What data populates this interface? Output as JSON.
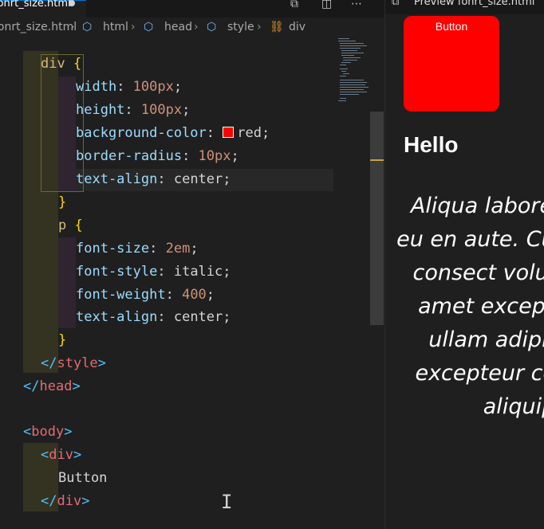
{
  "editor": {
    "active_tab": "fonrt_size.html",
    "breadcrumb": [
      "fonrt_size.html",
      "html",
      "head",
      "style",
      "div"
    ],
    "code_lines": {
      "l1_sel": "div",
      "l1_brace": " {",
      "width_prop": "width",
      "width_val": "100px",
      "height_prop": "height",
      "height_val": "100px",
      "bg_prop": "background-color",
      "bg_val": "red",
      "radius_prop": "border-radius",
      "radius_val": "10px",
      "talign_prop": "text-align",
      "talign_val": "center",
      "close_brace": "}",
      "p_sel": "p",
      "p_brace": " {",
      "fsize_prop": "font-size",
      "fsize_val": "2em",
      "fstyle_prop": "font-style",
      "fstyle_val": "italic",
      "fweight_prop": "font-weight",
      "fweight_val": "400",
      "talign2_prop": "text-align",
      "talign2_val": "center",
      "close_brace2": "}",
      "style_close": "style",
      "head_close": "head",
      "body_open": "body",
      "div_open": "div",
      "div_text": "Button",
      "div_close": "div"
    }
  },
  "preview": {
    "tab_title": "Preview fonrt_size.html",
    "box_text": "Button",
    "heading": "Hello",
    "paragraph": "Aliqua labore dolore eu en aute. Cupid sunt consect voluptate e amet excep labore ullam adipisicing excepteur co mollit aliquip",
    "box_color": "#ff0000"
  },
  "icons": {
    "split_preview": "split-preview-icon",
    "split_editor": "split-editor-icon",
    "more": "more-icon",
    "cube": "symbol-cube-icon",
    "chevron": "chevron-right-icon",
    "style_symbol": "symbol-struct-icon"
  }
}
